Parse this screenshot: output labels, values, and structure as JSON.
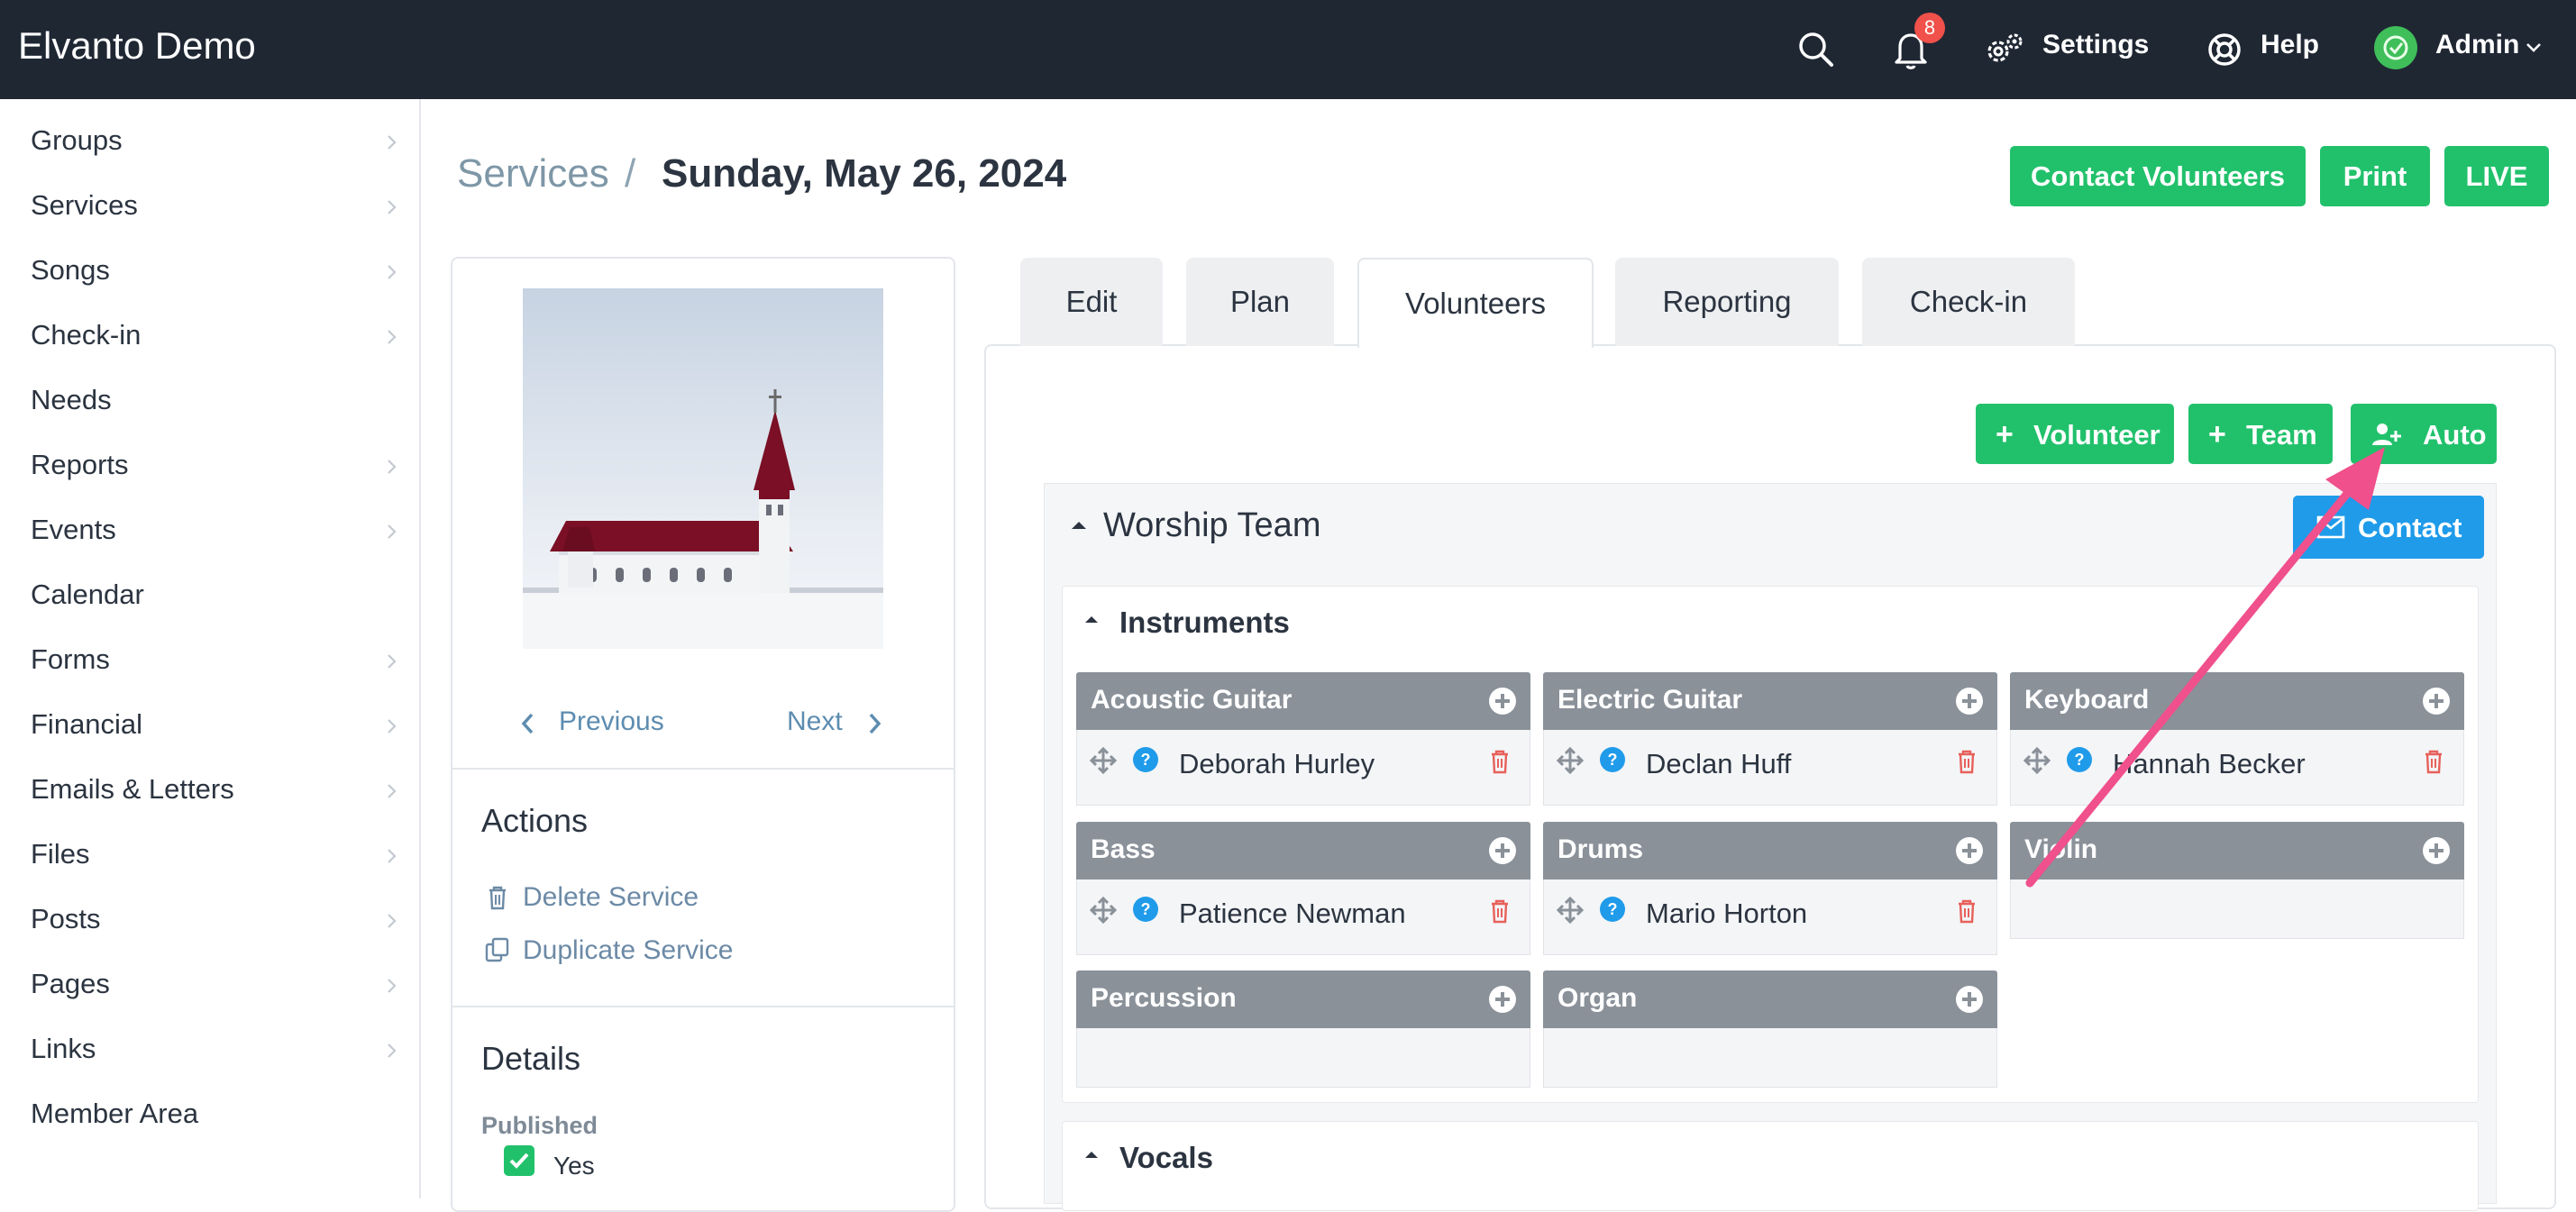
{
  "app": {
    "title": "Elvanto Demo"
  },
  "topbar": {
    "notification_count": "8",
    "settings_label": "Settings",
    "help_label": "Help",
    "user_label": "Admin"
  },
  "sidebar": {
    "items": [
      {
        "label": "Groups",
        "chevron": true
      },
      {
        "label": "Services",
        "chevron": true
      },
      {
        "label": "Songs",
        "chevron": true
      },
      {
        "label": "Check-in",
        "chevron": true
      },
      {
        "label": "Needs",
        "chevron": false
      },
      {
        "label": "Reports",
        "chevron": true
      },
      {
        "label": "Events",
        "chevron": true
      },
      {
        "label": "Calendar",
        "chevron": false
      },
      {
        "label": "Forms",
        "chevron": true
      },
      {
        "label": "Financial",
        "chevron": true
      },
      {
        "label": "Emails & Letters",
        "chevron": true
      },
      {
        "label": "Files",
        "chevron": true
      },
      {
        "label": "Posts",
        "chevron": true
      },
      {
        "label": "Pages",
        "chevron": true
      },
      {
        "label": "Links",
        "chevron": true
      },
      {
        "label": "Member Area",
        "chevron": false
      }
    ]
  },
  "header": {
    "breadcrumb_root": "Services",
    "breadcrumb_sep": "/",
    "title": "Sunday, May 26, 2024",
    "buttons": {
      "contact_volunteers": "Contact Volunteers",
      "print": "Print",
      "live": "LIVE"
    }
  },
  "service_card": {
    "previous": "Previous",
    "next": "Next",
    "actions_heading": "Actions",
    "delete": "Delete Service",
    "duplicate": "Duplicate Service",
    "details_heading": "Details",
    "published_label": "Published",
    "published_value": "Yes"
  },
  "tabs": [
    "Edit",
    "Plan",
    "Volunteers",
    "Reporting",
    "Check-in"
  ],
  "active_tab": "Volunteers",
  "volunteers": {
    "add_volunteer": "Volunteer",
    "add_team": "Team",
    "auto": "Auto",
    "team": {
      "name": "Worship Team",
      "contact": "Contact",
      "departments": [
        {
          "name": "Instruments",
          "positions": [
            {
              "name": "Acoustic Guitar",
              "volunteers": [
                "Deborah Hurley"
              ]
            },
            {
              "name": "Electric Guitar",
              "volunteers": [
                "Declan Huff"
              ]
            },
            {
              "name": "Keyboard",
              "volunteers": [
                "Hannah Becker"
              ]
            },
            {
              "name": "Bass",
              "volunteers": [
                "Patience Newman"
              ]
            },
            {
              "name": "Drums",
              "volunteers": [
                "Mario Horton"
              ]
            },
            {
              "name": "Violin",
              "volunteers": []
            },
            {
              "name": "Percussion",
              "volunteers": []
            },
            {
              "name": "Organ",
              "volunteers": []
            }
          ]
        },
        {
          "name": "Vocals",
          "positions": []
        }
      ]
    }
  },
  "colors": {
    "topbar": "#1f2733",
    "green": "#21c16b",
    "blue": "#1f9bea",
    "position_header": "#8a9199",
    "annotation_arrow": "#f0508c",
    "delete_icon": "#e7605a",
    "info_icon": "#1f9bea"
  }
}
